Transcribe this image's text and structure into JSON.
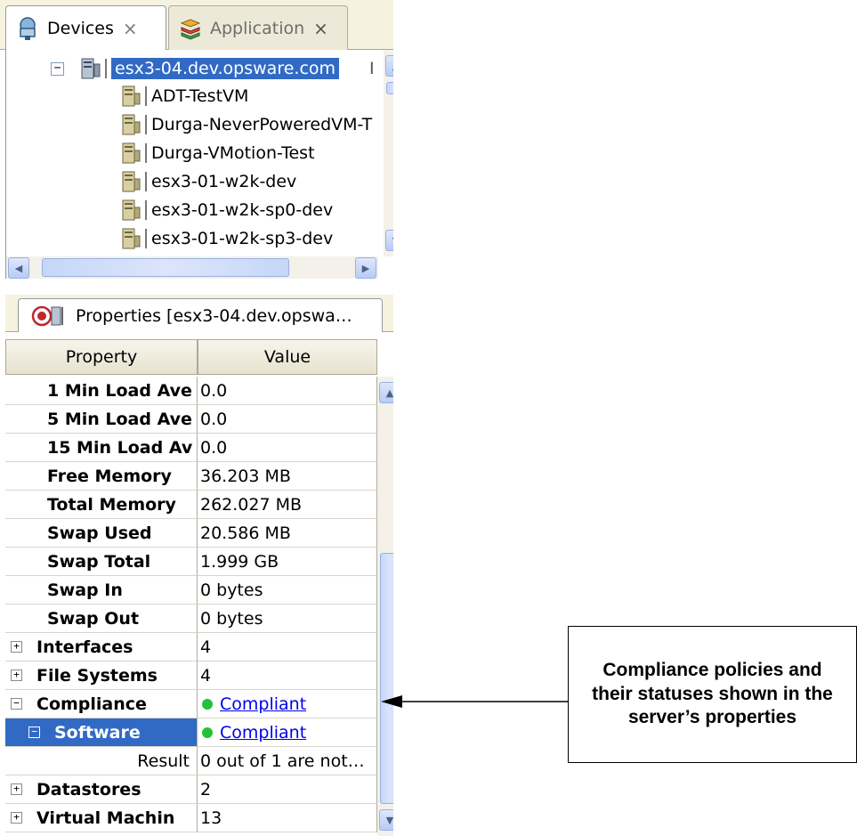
{
  "tabs": [
    {
      "label": "Devices",
      "close": "×",
      "icon": "devices-icon"
    },
    {
      "label": "Application",
      "close": "×",
      "icon": "application-icon"
    }
  ],
  "device_tree": {
    "root": "esx3-04.dev.opsware.com",
    "root_expander": "−",
    "root_suffix": "I",
    "children": [
      "ADT-TestVM",
      "Durga-NeverPoweredVM-T",
      "Durga-VMotion-Test",
      "esx3-01-w2k-dev",
      "esx3-01-w2k-sp0-dev",
      "esx3-01-w2k-sp3-dev"
    ]
  },
  "properties_panel": {
    "title": "Properties [esx3-04.dev.opswa…",
    "columns": [
      "Property",
      "Value"
    ],
    "rows": [
      {
        "name": "1 Min Load Ave",
        "value": "0.0"
      },
      {
        "name": "5 Min Load Ave",
        "value": "0.0"
      },
      {
        "name": "15 Min Load Av",
        "value": "0.0"
      },
      {
        "name": "Free Memory",
        "value": "36.203 MB"
      },
      {
        "name": "Total Memory",
        "value": "262.027 MB"
      },
      {
        "name": "Swap Used",
        "value": "20.586 MB"
      },
      {
        "name": "Swap Total",
        "value": "1.999 GB"
      },
      {
        "name": "Swap In",
        "value": "0 bytes"
      },
      {
        "name": "Swap Out",
        "value": "0 bytes"
      },
      {
        "name": "Interfaces",
        "value": "4",
        "expander": "+"
      },
      {
        "name": "File Systems",
        "value": "4",
        "expander": "+"
      },
      {
        "name": "Compliance",
        "value": "Compliant",
        "expander": "−",
        "status": "green"
      },
      {
        "name": "Software",
        "value": "Compliant",
        "expander": "−",
        "status": "green",
        "selected": true
      },
      {
        "name": "Result",
        "value": "0 out of 1 are not…"
      },
      {
        "name": "Datastores",
        "value": "2",
        "expander": "+"
      },
      {
        "name": "Virtual Machin",
        "value": "13",
        "expander": "+"
      }
    ]
  },
  "callout": {
    "text": "Compliance policies and their statuses shown in the server’s properties"
  },
  "colors": {
    "selection": "#316ac5",
    "compliant": "#23c23a",
    "link": "#0000ee",
    "tab_bg": "#f5f3df"
  }
}
